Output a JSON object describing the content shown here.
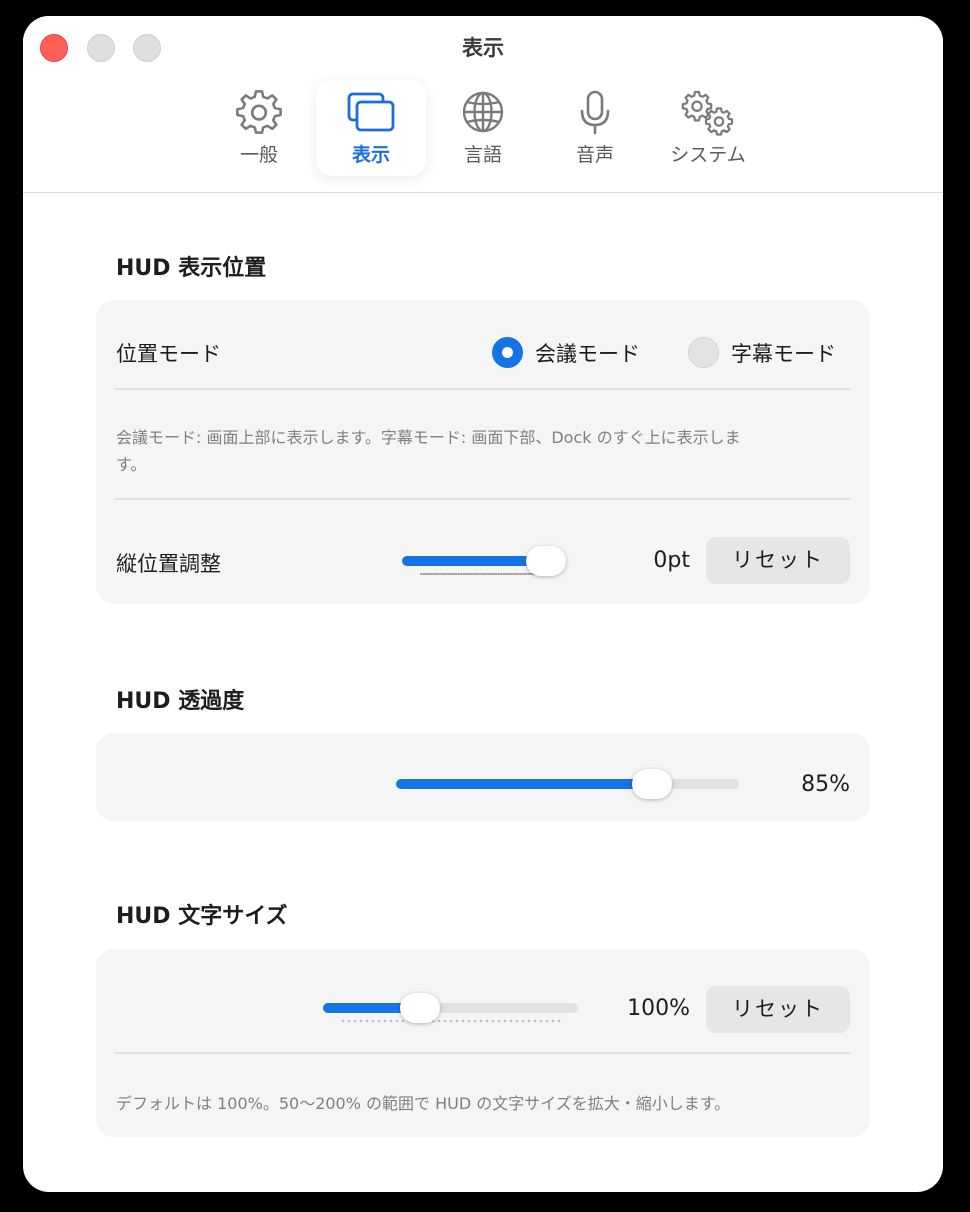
{
  "window": {
    "title": "表示"
  },
  "tabs": [
    {
      "label": "一般",
      "icon": "gear-icon",
      "active": false
    },
    {
      "label": "表示",
      "icon": "display-icon",
      "active": true
    },
    {
      "label": "言語",
      "icon": "globe-icon",
      "active": false
    },
    {
      "label": "音声",
      "icon": "microphone-icon",
      "active": false
    },
    {
      "label": "システム",
      "icon": "gears-icon",
      "active": false
    }
  ],
  "hud_position": {
    "title": "HUD 表示位置",
    "mode_label": "位置モード",
    "mode_options": [
      {
        "label": "会議モード",
        "selected": true
      },
      {
        "label": "字幕モード",
        "selected": false
      }
    ],
    "description": "会議モード: 画面上部に表示します。字幕モード: 画面下部、Dock のすぐ上に表示します。",
    "vertical_label": "縦位置調整",
    "vertical_value": "0pt",
    "vertical_fraction": 1.0,
    "reset_label": "リセット"
  },
  "hud_opacity": {
    "title": "HUD 透過度",
    "value": "85%",
    "fraction": 0.78
  },
  "hud_text_size": {
    "title": "HUD 文字サイズ",
    "value": "100%",
    "fraction": 0.36,
    "reset_label": "リセット",
    "description": "デフォルトは 100%。50〜200% の範囲で HUD の文字サイズを拡大・縮小します。"
  },
  "colors": {
    "accent": "#1673e6",
    "close": "#ff5f57",
    "card_bg": "#f5f5f5"
  }
}
